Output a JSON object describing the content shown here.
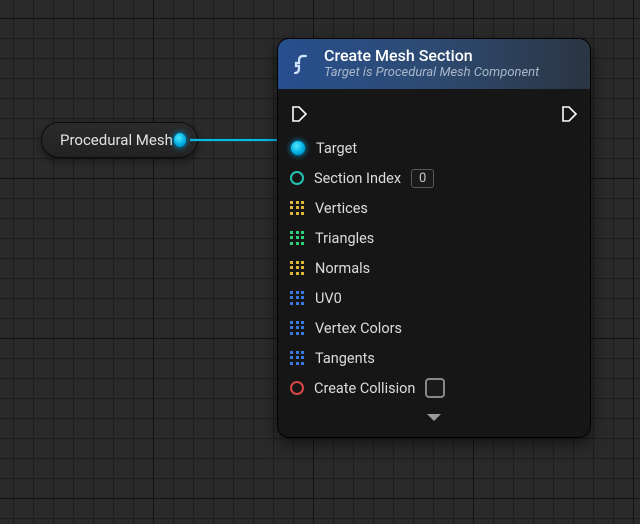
{
  "source_node": {
    "label": "Procedural Mesh"
  },
  "node": {
    "title": "Create Mesh Section",
    "subtitle": "Target is Procedural Mesh Component",
    "inputs": {
      "target": "Target",
      "section_index_label": "Section Index",
      "section_index_value": "0",
      "vertices": "Vertices",
      "triangles": "Triangles",
      "normals": "Normals",
      "uv0": "UV0",
      "vertex_colors": "Vertex Colors",
      "tangents": "Tangents",
      "create_collision": "Create Collision"
    }
  }
}
